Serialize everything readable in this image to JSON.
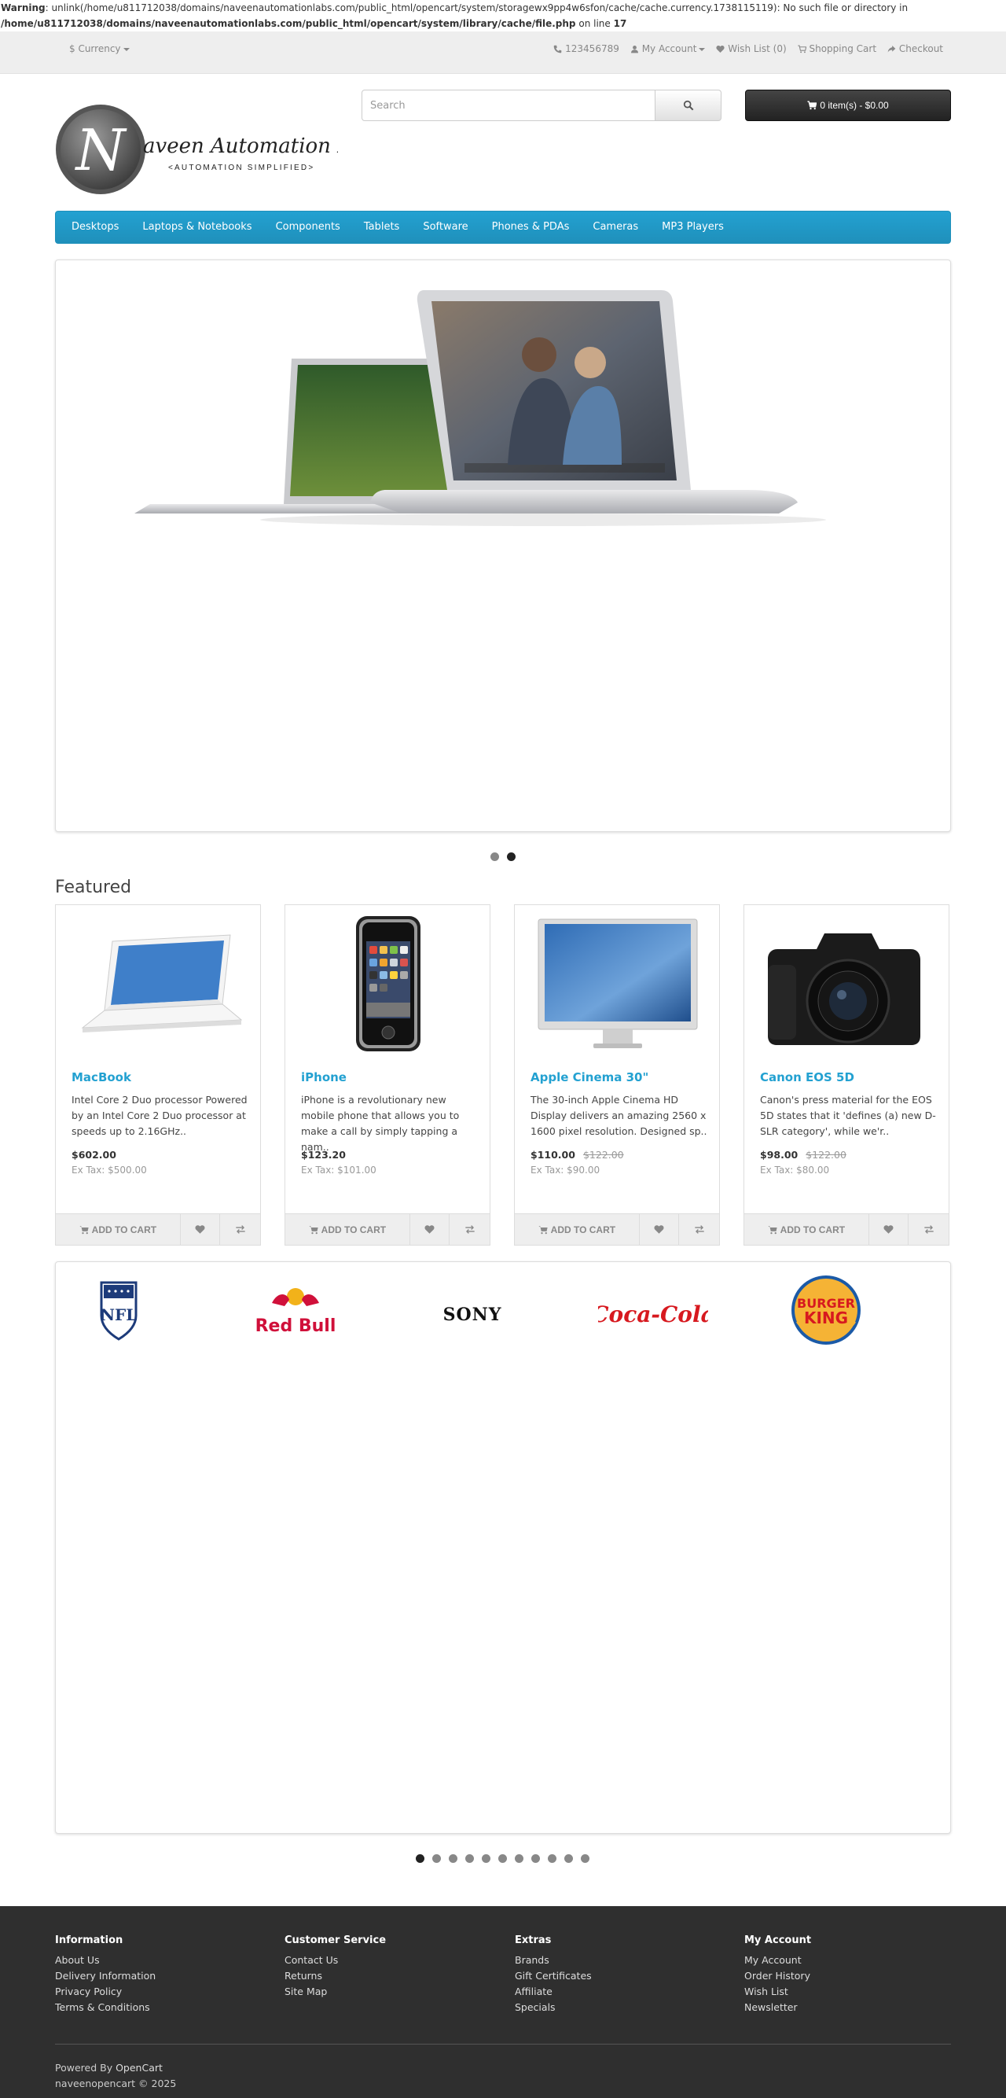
{
  "warning": {
    "label": "Warning",
    "text": ": unlink(/home/u811712038/domains/naveenautomationlabs.com/public_html/opencart/system/storagewx9pp4w6sfon/cache/cache.currency.1738115119): No such file or directory in",
    "path": "/home/u811712038/domains/naveenautomationlabs.com/public_html/opencart/system/library/cache/file.php",
    "on_line": "on line",
    "line": "17"
  },
  "topbar": {
    "currency": "$ Currency",
    "phone": "123456789",
    "my_account": "My Account",
    "wish_list": "Wish List (0)",
    "shopping_cart": "Shopping Cart",
    "checkout": "Checkout"
  },
  "logo": {
    "brand_initial": "N",
    "brand_name": "aveen Automation Labs",
    "tagline": "<AUTOMATION SIMPLIFIED>"
  },
  "search": {
    "placeholder": "Search"
  },
  "cart": {
    "label": "0 item(s) - $0.00"
  },
  "menu": {
    "items": [
      "Desktops",
      "Laptops & Notebooks",
      "Components",
      "Tablets",
      "Software",
      "Phones & PDAs",
      "Cameras",
      "MP3 Players"
    ]
  },
  "slideshow": {
    "active_index": 2,
    "count": 2
  },
  "featured": {
    "title": "Featured",
    "products": [
      {
        "name": "MacBook",
        "desc": "Intel Core 2 Duo processor Powered by an Intel Core 2 Duo processor at speeds up to 2.16GHz..",
        "price": "$602.00",
        "old_price": "",
        "ex_tax": "Ex Tax: $500.00"
      },
      {
        "name": "iPhone",
        "desc": "iPhone is a revolutionary new mobile phone that allows you to make a call by simply tapping a nam..",
        "price": "$123.20",
        "old_price": "",
        "ex_tax": "Ex Tax: $101.00"
      },
      {
        "name": "Apple Cinema 30\"",
        "desc": "The 30-inch Apple Cinema HD Display delivers an amazing 2560 x 1600 pixel resolution. Designed sp..",
        "price": "$110.00",
        "old_price": "$122.00",
        "ex_tax": "Ex Tax: $90.00"
      },
      {
        "name": "Canon EOS 5D",
        "desc": "Canon's press material for the EOS 5D states that it 'defines (a) new D-SLR category', while we'r..",
        "price": "$98.00",
        "old_price": "$122.00",
        "ex_tax": "Ex Tax: $80.00"
      }
    ],
    "add_to_cart": "ADD TO CART"
  },
  "brands": {
    "nfl": "NFL",
    "redbull": "Red Bull",
    "sony": "SONY",
    "cocacola": "Coca-Cola",
    "bk_top": "BURGER",
    "bk_bottom": "KING",
    "dots_count": 11,
    "active_dot": 1
  },
  "footer": {
    "information": {
      "title": "Information",
      "links": [
        "About Us",
        "Delivery Information",
        "Privacy Policy",
        "Terms & Conditions"
      ]
    },
    "customer_service": {
      "title": "Customer Service",
      "links": [
        "Contact Us",
        "Returns",
        "Site Map"
      ]
    },
    "extras": {
      "title": "Extras",
      "links": [
        "Brands",
        "Gift Certificates",
        "Affiliate",
        "Specials"
      ]
    },
    "my_account": {
      "title": "My Account",
      "links": [
        "My Account",
        "Order History",
        "Wish List",
        "Newsletter"
      ]
    },
    "powered_by": "Powered By",
    "opencart": "OpenCart",
    "copyright": "naveenopencart © 2025"
  },
  "colors": {
    "accent": "#23a1d1",
    "footer_bg": "#2f2f2f",
    "topbar_bg": "#eeeeee"
  }
}
